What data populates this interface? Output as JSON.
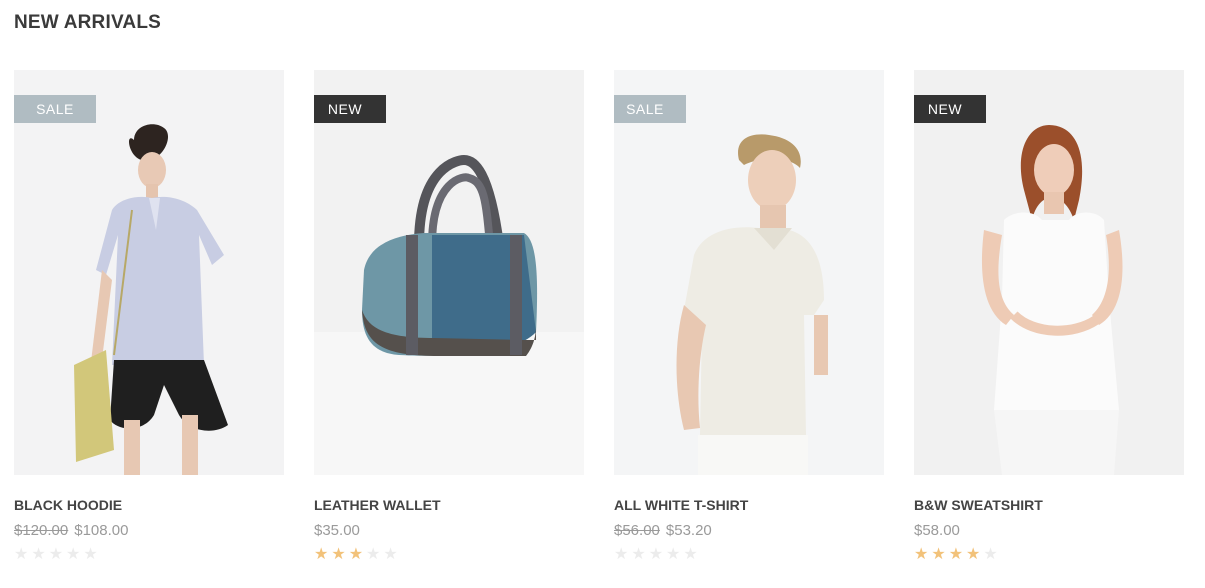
{
  "section": {
    "title": "NEW ARRIVALS"
  },
  "products": [
    {
      "name": "BLACK HOODIE",
      "badge": "SALE",
      "badge_type": "sale",
      "old_price": "$120.00",
      "price": "$108.00",
      "rating": 0,
      "image_icon": "woman-shirt-shorts-photo"
    },
    {
      "name": "LEATHER WALLET",
      "badge": "NEW",
      "badge_type": "new",
      "old_price": "",
      "price": "$35.00",
      "rating": 3,
      "image_icon": "denim-bag-photo"
    },
    {
      "name": "ALL WHITE T-SHIRT",
      "badge": "SALE",
      "badge_type": "sale",
      "old_price": "$56.00",
      "price": "$53.20",
      "rating": 0,
      "image_icon": "man-white-tshirt-photo"
    },
    {
      "name": "B&W SWEATSHIRT",
      "badge": "NEW",
      "badge_type": "new",
      "old_price": "",
      "price": "$58.00",
      "rating": 4,
      "image_icon": "woman-white-top-photo"
    }
  ],
  "colors": {
    "sale_badge": "#b0bcc2",
    "new_badge": "#333333",
    "star_filled": "#f2c27a",
    "star_empty": "#ececec"
  }
}
